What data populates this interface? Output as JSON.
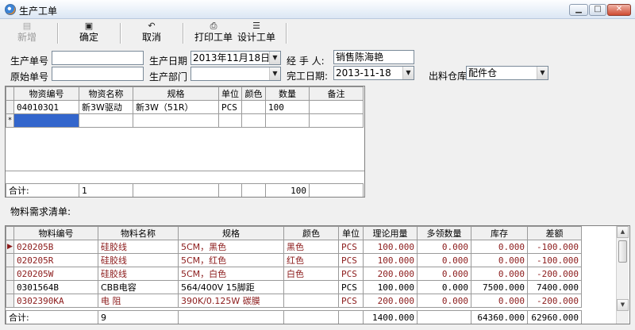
{
  "window": {
    "title": "生产工单"
  },
  "toolbar": {
    "new_label": "新增",
    "confirm_label": "确定",
    "cancel_label": "取消",
    "print_label": "打印工单",
    "design_label": "设计工单"
  },
  "form": {
    "order_no_label": "生产单号",
    "order_no_value": "",
    "orig_no_label": "原始单号",
    "orig_no_value": "",
    "date_label": "生产日期",
    "date_value": "2013年11月18日",
    "dept_label": "生产部门",
    "dept_value": "",
    "handler_label": "经 手 人:",
    "handler_value": "销售陈海艳",
    "finish_label": "完工日期:",
    "finish_value": "2013-11-18",
    "warehouse_label": "出料仓库:",
    "warehouse_value": "配件仓"
  },
  "top_grid": {
    "headers": [
      "物资编号",
      "物资名称",
      "规格",
      "单位",
      "颜色",
      "数量",
      "备注"
    ],
    "rows": [
      [
        "040103Q1",
        "新3W驱动",
        "新3W（51R）",
        "PCS",
        "",
        "100",
        ""
      ]
    ],
    "new_row_marker": "*",
    "total_label": "合计:",
    "total_count": "1",
    "total_qty": "100"
  },
  "req_label": "物料需求清单:",
  "bottom_grid": {
    "headers": [
      "物料编号",
      "物料名称",
      "规格",
      "颜色",
      "单位",
      "理论用量",
      "多领数量",
      "库存",
      "差额"
    ],
    "rows": [
      [
        "020205B",
        "硅胶线",
        "5CM，黑色",
        "黑色",
        "PCS",
        "100.000",
        "0.000",
        "0.000",
        "-100.000"
      ],
      [
        "020205R",
        "硅胶线",
        "5CM，红色",
        "红色",
        "PCS",
        "100.000",
        "0.000",
        "0.000",
        "-100.000"
      ],
      [
        "020205W",
        "硅胶线",
        "5CM，白色",
        "白色",
        "PCS",
        "200.000",
        "0.000",
        "0.000",
        "-200.000"
      ],
      [
        "0301564B",
        "CBB电容",
        "564/400V 15脚距",
        "",
        "PCS",
        "100.000",
        "0.000",
        "7500.000",
        "7400.000"
      ],
      [
        "0302390KA",
        "电 阻",
        "390K/0.125W 碳膜",
        "",
        "PCS",
        "200.000",
        "0.000",
        "0.000",
        "-200.000"
      ]
    ],
    "current_row_marker": "▶",
    "total_label": "合计:",
    "total_count": "9",
    "total_usage": "1400.000",
    "total_stock": "64360.000",
    "total_diff": "62960.000"
  },
  "colors": {
    "shortage_text": "#8b1a1a",
    "selection": "#3366cc"
  }
}
